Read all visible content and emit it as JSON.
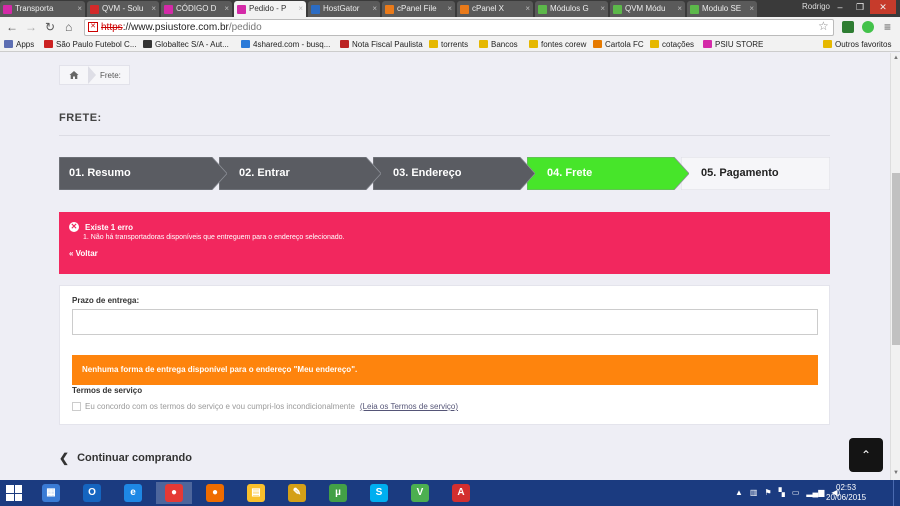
{
  "browser": {
    "tabs": [
      {
        "label": "Transporta",
        "color": "#d42aa8",
        "glyph": "P"
      },
      {
        "label": "QVM - Solu",
        "color": "#d42a2a",
        "glyph": "Q"
      },
      {
        "label": "CÓDIGO D",
        "color": "#d42aa8",
        "glyph": "P"
      },
      {
        "label": "Pedido - P",
        "color": "#d42aa8",
        "glyph": "P"
      },
      {
        "label": "HostGator",
        "color": "#2b6cc4",
        "glyph": "H"
      },
      {
        "label": "cPanel File",
        "color": "#e97a1a",
        "glyph": "cP"
      },
      {
        "label": "cPanel X",
        "color": "#e97a1a",
        "glyph": "cP"
      },
      {
        "label": "Módulos G",
        "color": "#5cb84a",
        "glyph": "M"
      },
      {
        "label": "QVM Módu",
        "color": "#5cb84a",
        "glyph": "Q"
      },
      {
        "label": "Modulo SE",
        "color": "#5cb84a",
        "glyph": "M"
      }
    ],
    "user": "Rodrigo",
    "url_scheme": "https",
    "url_host": "://www.psiustore.com.br",
    "url_path": "/pedido",
    "bookmarks": [
      {
        "label": "Apps",
        "color": "#5d6fb3"
      },
      {
        "label": "São Paulo Futebol C...",
        "color": "#c22"
      },
      {
        "label": "Globaltec S/A - Aut...",
        "color": "#333"
      },
      {
        "label": "4shared.com - busq...",
        "color": "#2b7ad8"
      },
      {
        "label": "Nota Fiscal Paulista",
        "color": "#b22"
      },
      {
        "label": "torrents",
        "color": "#e6b800"
      },
      {
        "label": "Bancos",
        "color": "#e6b800"
      },
      {
        "label": "fontes corew",
        "color": "#e6b800"
      },
      {
        "label": "Cartola FC",
        "color": "#e67a00"
      },
      {
        "label": "cotações",
        "color": "#e6b800"
      },
      {
        "label": "PSIU STORE",
        "color": "#d42aa8"
      },
      {
        "label": "Outros favoritos",
        "color": "#e6b800"
      }
    ]
  },
  "breadcrumb": {
    "current": "Frete:"
  },
  "page_title": "FRETE:",
  "steps": [
    {
      "label": "01. Resumo",
      "color": "#5a5c62"
    },
    {
      "label": "02. Entrar",
      "color": "#5a5c62"
    },
    {
      "label": "03. Endereço",
      "color": "#5a5c62"
    },
    {
      "label": "04. Frete",
      "color": "#47e52a"
    },
    {
      "label": "05. Pagamento",
      "color": "#f6f6f9"
    }
  ],
  "alert": {
    "title": "Existe 1 erro",
    "message": "1.  Não há transportadoras disponíveis que entreguem para o endereço selecionado.",
    "back_link": "« Voltar",
    "color": "#f2275e"
  },
  "delivery": {
    "label": "Prazo de entrega:",
    "value": "",
    "warning": "Nenhuma forma de entrega disponível para o endereço \"Meu endereço\".",
    "warning_color": "#fe840d"
  },
  "terms": {
    "title": "Termos de serviço",
    "text": "Eu concordo com os termos do serviço e vou cumpri-los incondicionalmente",
    "link": "(Leia os Termos de serviço)"
  },
  "continue_label": "Continuar comprando",
  "taskbar": {
    "apps": [
      {
        "icon": "network-icon",
        "color": "#3a7bd5",
        "glyph": "▦"
      },
      {
        "icon": "outlook-icon",
        "color": "#1565c0",
        "glyph": "O"
      },
      {
        "icon": "internet-explorer-icon",
        "color": "#1e88e5",
        "glyph": "e"
      },
      {
        "icon": "chrome-icon",
        "color": "#e53935",
        "glyph": "●"
      },
      {
        "icon": "firefox-icon",
        "color": "#ef6c00",
        "glyph": "●"
      },
      {
        "icon": "explorer-icon",
        "color": "#f9c02c",
        "glyph": "▤"
      },
      {
        "icon": "tool-icon",
        "color": "#d4a017",
        "glyph": "✎"
      },
      {
        "icon": "utorrent-icon",
        "color": "#43a047",
        "glyph": "µ"
      },
      {
        "icon": "skype-icon",
        "color": "#00aff0",
        "glyph": "S"
      },
      {
        "icon": "vine-icon",
        "color": "#4caf50",
        "glyph": "V"
      },
      {
        "icon": "app-icon",
        "color": "#d32f2f",
        "glyph": "A"
      }
    ],
    "time": "02:53",
    "date": "20/06/2015"
  }
}
